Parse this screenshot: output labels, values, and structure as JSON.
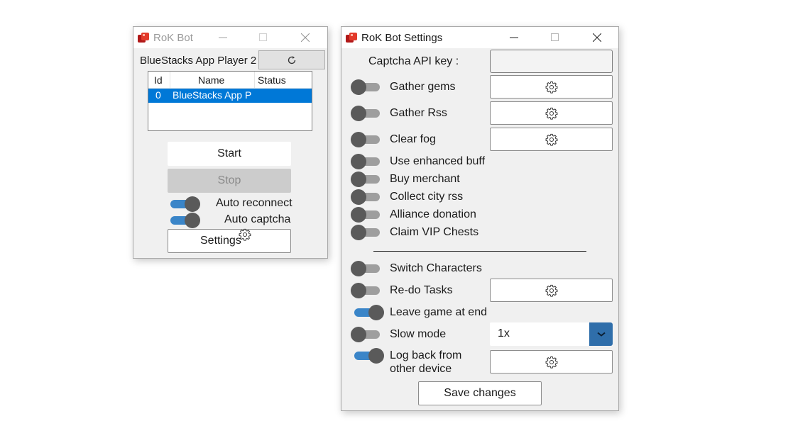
{
  "bot_window": {
    "title": "RoK Bot",
    "device_dropdown": "BlueStacks App Player 2",
    "table": {
      "columns": [
        "Id",
        "Name",
        "Status"
      ],
      "rows": [
        {
          "id": "0",
          "name": "BlueStacks App P",
          "status": ""
        }
      ]
    },
    "start_label": "Start",
    "stop_label": "Stop",
    "auto_reconnect_label": "Auto reconnect",
    "auto_reconnect_on": true,
    "auto_captcha_label": "Auto captcha",
    "auto_captcha_on": true,
    "settings_label": "Settings"
  },
  "settings_window": {
    "title": "RoK Bot Settings",
    "captcha_label": "Captcha API key :",
    "captcha_value": "",
    "options": {
      "gather_gems": {
        "label": "Gather gems",
        "on": false
      },
      "gather_rss": {
        "label": "Gather Rss",
        "on": false
      },
      "clear_fog": {
        "label": "Clear fog",
        "on": false
      },
      "enhanced_buff": {
        "label": "Use enhanced buff",
        "on": false
      },
      "buy_merchant": {
        "label": "Buy merchant",
        "on": false
      },
      "collect_city_rss": {
        "label": "Collect city rss",
        "on": false
      },
      "alliance_donation": {
        "label": "Alliance donation",
        "on": false
      },
      "claim_vip": {
        "label": "Claim VIP Chests",
        "on": false
      },
      "switch_characters": {
        "label": "Switch Characters",
        "on": false
      },
      "redo_tasks": {
        "label": "Re-do Tasks",
        "on": false
      },
      "leave_game": {
        "label": "Leave game at end",
        "on": true
      },
      "slow_mode": {
        "label": "Slow mode",
        "on": false
      },
      "log_back_line1": {
        "label": "Log back from",
        "on": true
      },
      "log_back_line2": {
        "label": "other device"
      }
    },
    "slow_mode_value": "1x",
    "save_label": "Save changes"
  },
  "colors": {
    "accent": "#3a85c8",
    "selection": "#0078d7",
    "dropdown_button": "#2f6eaa"
  }
}
